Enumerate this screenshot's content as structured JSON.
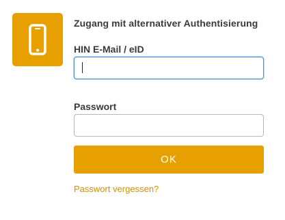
{
  "app_icon": {
    "name": "smartphone-icon",
    "background": "#e8a000",
    "foreground": "#ffffff"
  },
  "login": {
    "heading": "Zugang mit alternativer Authentisierung",
    "email_label": "HIN E-Mail / eID",
    "email_value": "",
    "password_label": "Passwort",
    "password_value": "",
    "submit_label": "OK",
    "forgot_password": "Passwort vergessen?"
  },
  "colors": {
    "accent": "#e8a000",
    "link": "#d48f00",
    "focus_border": "#4a90d9",
    "text": "#3a3a3a"
  }
}
